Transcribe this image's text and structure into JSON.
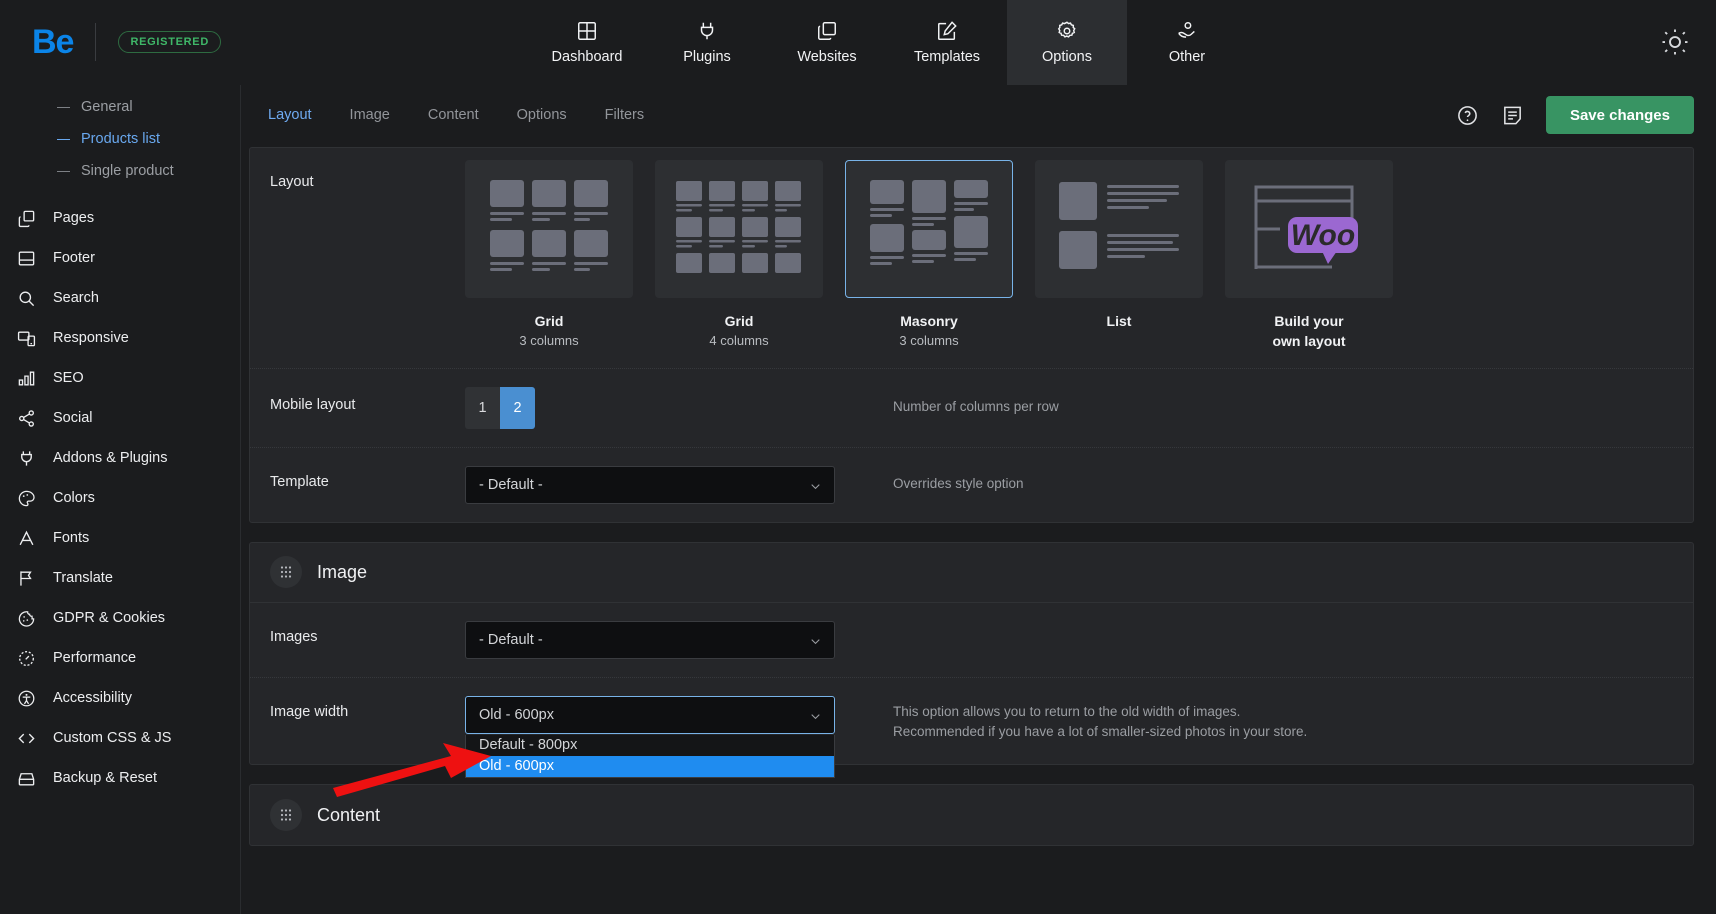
{
  "topbar": {
    "logo": "Be",
    "badge": "REGISTERED",
    "nav": [
      {
        "label": "Dashboard",
        "icon": "grid-icon",
        "active": false
      },
      {
        "label": "Plugins",
        "icon": "plug-icon",
        "active": false
      },
      {
        "label": "Websites",
        "icon": "copy-icon",
        "active": false
      },
      {
        "label": "Templates",
        "icon": "edit-square-icon",
        "active": false
      },
      {
        "label": "Options",
        "icon": "gear-icon",
        "active": true
      },
      {
        "label": "Other",
        "icon": "hand-user-icon",
        "active": false
      }
    ],
    "theme_icon": "sun-icon"
  },
  "sidebar": {
    "sub_items": [
      {
        "label": "General",
        "active": false
      },
      {
        "label": "Products list",
        "active": true
      },
      {
        "label": "Single product",
        "active": false
      }
    ],
    "items": [
      {
        "label": "Pages",
        "icon": "pages-icon"
      },
      {
        "label": "Footer",
        "icon": "footer-icon"
      },
      {
        "label": "Search",
        "icon": "search-icon"
      },
      {
        "label": "Responsive",
        "icon": "responsive-icon"
      },
      {
        "label": "SEO",
        "icon": "bar-chart-icon"
      },
      {
        "label": "Social",
        "icon": "share-icon"
      },
      {
        "label": "Addons & Plugins",
        "icon": "plug-icon"
      },
      {
        "label": "Colors",
        "icon": "palette-icon"
      },
      {
        "label": "Fonts",
        "icon": "letter-a-icon"
      },
      {
        "label": "Translate",
        "icon": "flag-icon"
      },
      {
        "label": "GDPR & Cookies",
        "icon": "cookie-icon"
      },
      {
        "label": "Performance",
        "icon": "gauge-icon"
      },
      {
        "label": "Accessibility",
        "icon": "accessibility-icon"
      },
      {
        "label": "Custom CSS & JS",
        "icon": "code-icon"
      },
      {
        "label": "Backup & Reset",
        "icon": "drive-icon"
      }
    ]
  },
  "tabs": [
    {
      "label": "Layout",
      "active": true
    },
    {
      "label": "Image",
      "active": false
    },
    {
      "label": "Content",
      "active": false
    },
    {
      "label": "Options",
      "active": false
    },
    {
      "label": "Filters",
      "active": false
    }
  ],
  "toolbar": {
    "help_icon": "question-circle-icon",
    "notes_icon": "note-icon",
    "save_label": "Save changes",
    "save_color": "#389463"
  },
  "layout_panel": {
    "layout_row_label": "Layout",
    "cards": [
      {
        "title": "Grid",
        "subtitle": "3 columns",
        "thumb": "grid-3",
        "selected": false
      },
      {
        "title": "Grid",
        "subtitle": "4 columns",
        "thumb": "grid-4",
        "selected": false
      },
      {
        "title": "Masonry",
        "subtitle": "3 columns",
        "thumb": "masonry-3",
        "selected": true
      },
      {
        "title": "List",
        "subtitle": "",
        "thumb": "list",
        "selected": false
      },
      {
        "title": "Build your",
        "subtitle": "own layout",
        "thumb": "woo",
        "selected": false
      }
    ],
    "mobile_row_label": "Mobile layout",
    "mobile_options": [
      {
        "label": "1",
        "selected": false
      },
      {
        "label": "2",
        "selected": true
      }
    ],
    "mobile_desc": "Number of columns per row",
    "template_row_label": "Template",
    "template_value": "- Default -",
    "template_desc": "Overrides style option"
  },
  "image_panel": {
    "title": "Image",
    "drag_icon": "drag-handle-icon",
    "images_row_label": "Images",
    "images_value": "- Default -",
    "width_row_label": "Image width",
    "width_value": "Old - 600px",
    "width_options": [
      {
        "label": "Default - 800px",
        "highlighted": false
      },
      {
        "label": "Old - 600px",
        "highlighted": true
      }
    ],
    "width_desc_line1": "This option allows you to return to the old width of images.",
    "width_desc_line2": "Recommended if you have a lot of smaller-sized photos in your store.",
    "accent_blue": "#1f8cf0"
  },
  "content_panel": {
    "title": "Content",
    "drag_icon": "drag-handle-icon"
  },
  "annotation": {
    "arrow_color": "#ee1111",
    "arrow_icon": "red-pointer-arrow"
  }
}
